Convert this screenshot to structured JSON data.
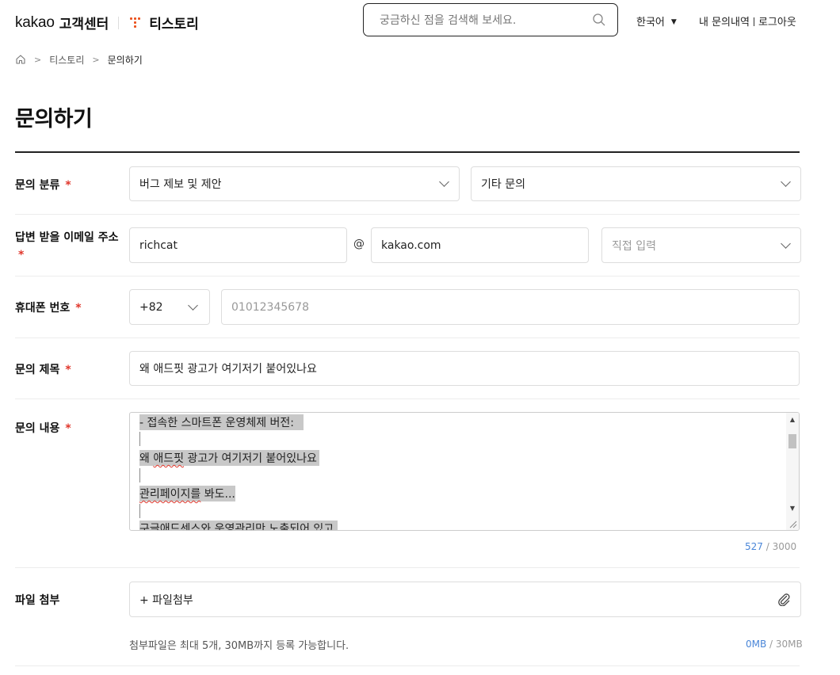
{
  "header": {
    "brand": "kakao",
    "brand_sub": "고객센터",
    "service": "티스토리",
    "search_placeholder": "궁금하신 점을 검색해 보세요.",
    "language": "한국어",
    "my_inquiries": "내 문의내역",
    "logout": "로그아웃"
  },
  "breadcrumb": {
    "items": [
      "티스토리",
      "문의하기"
    ]
  },
  "page_title": "문의하기",
  "form": {
    "category": {
      "label": "문의 분류",
      "primary": "버그 제보 및 제안",
      "secondary": "기타 문의"
    },
    "email": {
      "label": "답변 받을 이메일 주소",
      "id": "richcat",
      "at": "@",
      "domain": "kakao.com",
      "domain_select_placeholder": "직접 입력"
    },
    "phone": {
      "label": "휴대폰 번호",
      "country_code": "+82",
      "placeholder": "01012345678"
    },
    "subject": {
      "label": "문의 제목",
      "value": "왜 애드핏 광고가 여기저기 붙어있나요"
    },
    "content": {
      "label": "문의 내용",
      "lines": [
        "- 접속한 스마트폰 운영체제 버전:",
        "",
        "왜 애드핏 광고가 여기저기 붙어있나요",
        "",
        "관리페이지를 봐도...",
        "",
        "구글애드센스와 운영관리만 노출되어 있고"
      ],
      "count": "527",
      "max": "3000"
    },
    "attachment": {
      "label": "파일 첨부",
      "button": "+ 파일첨부",
      "note": "첨부파일은 최대 5개, 30MB까지 등록 가능합니다.",
      "used": "0MB",
      "limit": "30MB"
    },
    "required_mark": "*"
  },
  "colors": {
    "required": "#e0362b",
    "accent_blue": "#4a86d8",
    "tistory_orange": "#eb531f",
    "selection_gray": "#c8c8c8"
  },
  "icons": [
    "search-icon",
    "home-icon",
    "chevron-right-icon",
    "chevron-down-icon",
    "caret-down-icon",
    "paperclip-icon",
    "tistory-logo"
  ]
}
